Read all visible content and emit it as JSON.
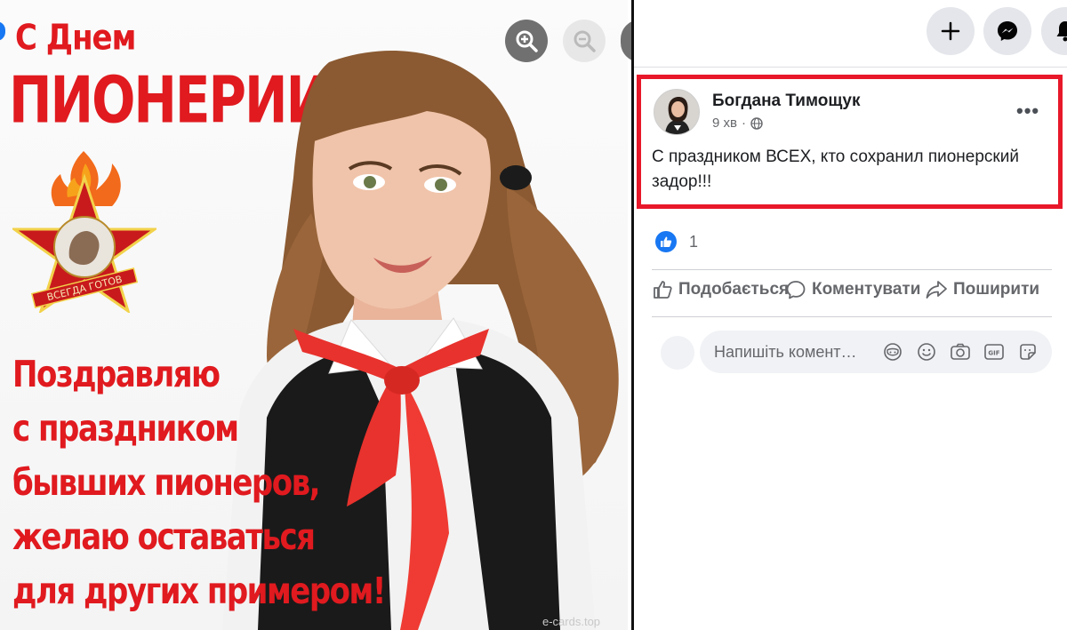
{
  "poster": {
    "title_line1": "С Днем",
    "title_line2": "ПИОНЕРИИ!",
    "badge_text": "ВСЕГДА ГОТОВ",
    "greeting_lines": [
      "Поздравляю",
      "с праздником",
      "бывших пионеров,",
      "желаю оставаться",
      "для других примером!"
    ],
    "watermark": "e-cards.top"
  },
  "viewer": {
    "icons": [
      "zoom-in-icon",
      "zoom-out-icon"
    ]
  },
  "topbar": {
    "icons": [
      "plus-icon",
      "messenger-icon",
      "bell-icon"
    ]
  },
  "post": {
    "author": "Богдана Тимощук",
    "time": "9 хв",
    "time_separator": "·",
    "audience_icon": "globe-icon",
    "more_label": "•••",
    "text": "С праздником ВСЕХ, кто сохранил пионерский задор!!!",
    "reactions_count": "1"
  },
  "actions": {
    "like": "Подобається",
    "comment": "Коментувати",
    "share": "Поширити"
  },
  "comment": {
    "placeholder": "Напишіть комент…",
    "icons": [
      "avatar-sticker-icon",
      "emoji-icon",
      "camera-icon",
      "gif-icon",
      "sticker-icon"
    ]
  },
  "colors": {
    "poster_red": "#e01a1f",
    "highlight_red": "#e8182a",
    "facebook_blue": "#1877f2",
    "muted_text": "#65676b"
  }
}
